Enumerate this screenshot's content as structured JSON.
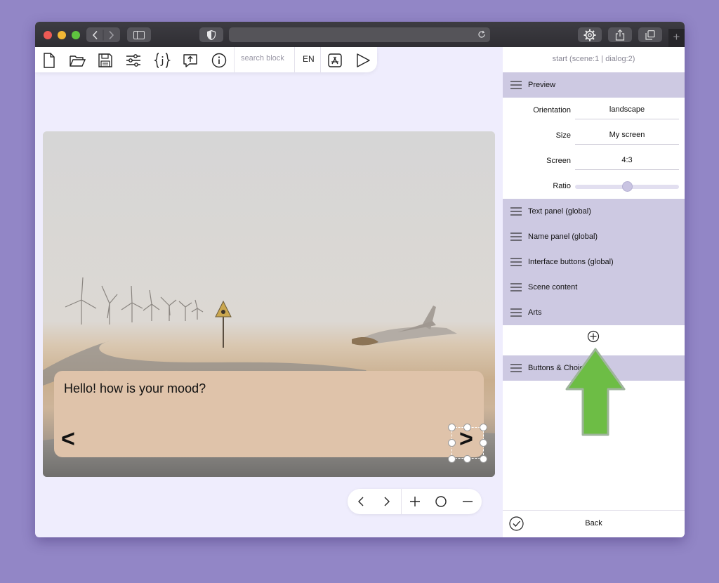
{
  "toolbar": {
    "search_placeholder": "search block",
    "language": "EN",
    "icons": [
      "new-file-icon",
      "open-folder-icon",
      "save-icon",
      "settings-sliders-icon",
      "json-icon",
      "upload-icon",
      "info-icon",
      "app-store-icon",
      "play-icon"
    ]
  },
  "stage": {
    "dialog_text": "Hello! how is your mood?",
    "prev_label": "<",
    "next_label": ">"
  },
  "panel": {
    "title": "start (scene:1 | dialog:2)",
    "preview": {
      "label": "Preview",
      "rows": [
        {
          "label": "Orientation",
          "value": "landscape"
        },
        {
          "label": "Size",
          "value": "My screen"
        },
        {
          "label": "Screen",
          "value": "4:3"
        }
      ],
      "ratio_label": "Ratio",
      "ratio_value": 0.5
    },
    "sections": [
      "Text panel (global)",
      "Name panel (global)",
      "Interface buttons (global)",
      "Scene content",
      "Arts"
    ],
    "buttons_section": "Buttons & Choices",
    "back_label": "Back"
  },
  "colors": {
    "accent_section": "#cdc9e2",
    "arrow": "#6dbd45",
    "textbox": "#dfc3aa"
  }
}
